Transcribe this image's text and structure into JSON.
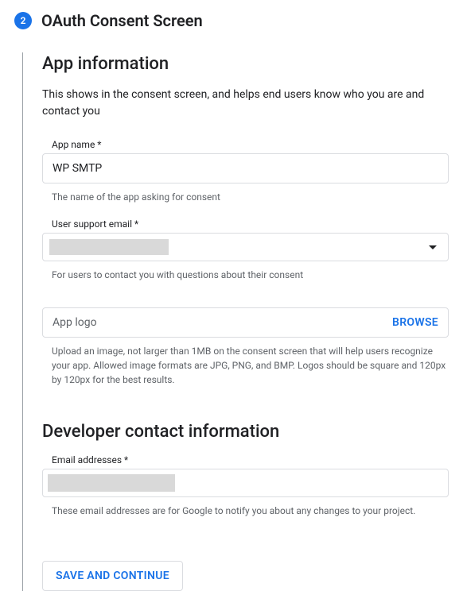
{
  "header": {
    "step_number": "2",
    "title": "OAuth Consent Screen"
  },
  "app_info": {
    "title": "App information",
    "description": "This shows in the consent screen, and helps end users know who you are and contact you",
    "app_name": {
      "label": "App name *",
      "value": "WP SMTP",
      "helper": "The name of the app asking for consent"
    },
    "support_email": {
      "label": "User support email *",
      "helper": "For users to contact you with questions about their consent"
    },
    "logo": {
      "label": "App logo",
      "browse": "BROWSE",
      "helper": "Upload an image, not larger than 1MB on the consent screen that will help users recognize your app. Allowed image formats are JPG, PNG, and BMP. Logos should be square and 120px by 120px for the best results."
    }
  },
  "dev_contact": {
    "title": "Developer contact information",
    "email": {
      "label": "Email addresses *",
      "helper": "These email addresses are for Google to notify you about any changes to your project."
    }
  },
  "actions": {
    "save": "SAVE AND CONTINUE"
  }
}
